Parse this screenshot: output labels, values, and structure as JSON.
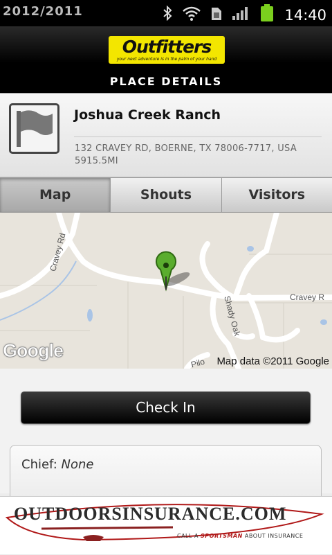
{
  "status_bar": {
    "date": "2012/2011",
    "battery_percent": "100%",
    "time": "14:40"
  },
  "header": {
    "logo_text": "Outfitters",
    "logo_tagline": "your next adventure is in the palm of your hand",
    "title": "PLACE DETAILS"
  },
  "place": {
    "name": "Joshua Creek Ranch",
    "address": "132 CRAVEY RD, BOERNE, TX 78006-7717, USA",
    "distance": "5915.5MI"
  },
  "tabs": [
    {
      "label": "Map",
      "active": true
    },
    {
      "label": "Shouts",
      "active": false
    },
    {
      "label": "Visitors",
      "active": false
    }
  ],
  "map": {
    "streets": [
      "Cravey Rd",
      "Cravey R",
      "Shady Oak"
    ],
    "google_logo": "Google",
    "attribution": "Map data ©2011 Google",
    "road_label_partial": "Pilo"
  },
  "actions": {
    "checkin_label": "Check In"
  },
  "details": {
    "chief_label": "Chief:",
    "chief_value": "None"
  },
  "ad": {
    "brand": "OUTDOORSINSURANCE.COM",
    "tagline_prefix": "CALL A",
    "tagline_brand": "SPORTSMAN",
    "tagline_suffix": "ABOUT INSURANCE"
  },
  "colors": {
    "logo_yellow": "#f3e600",
    "pin_green": "#5aad2e",
    "ad_red": "#b01818"
  }
}
